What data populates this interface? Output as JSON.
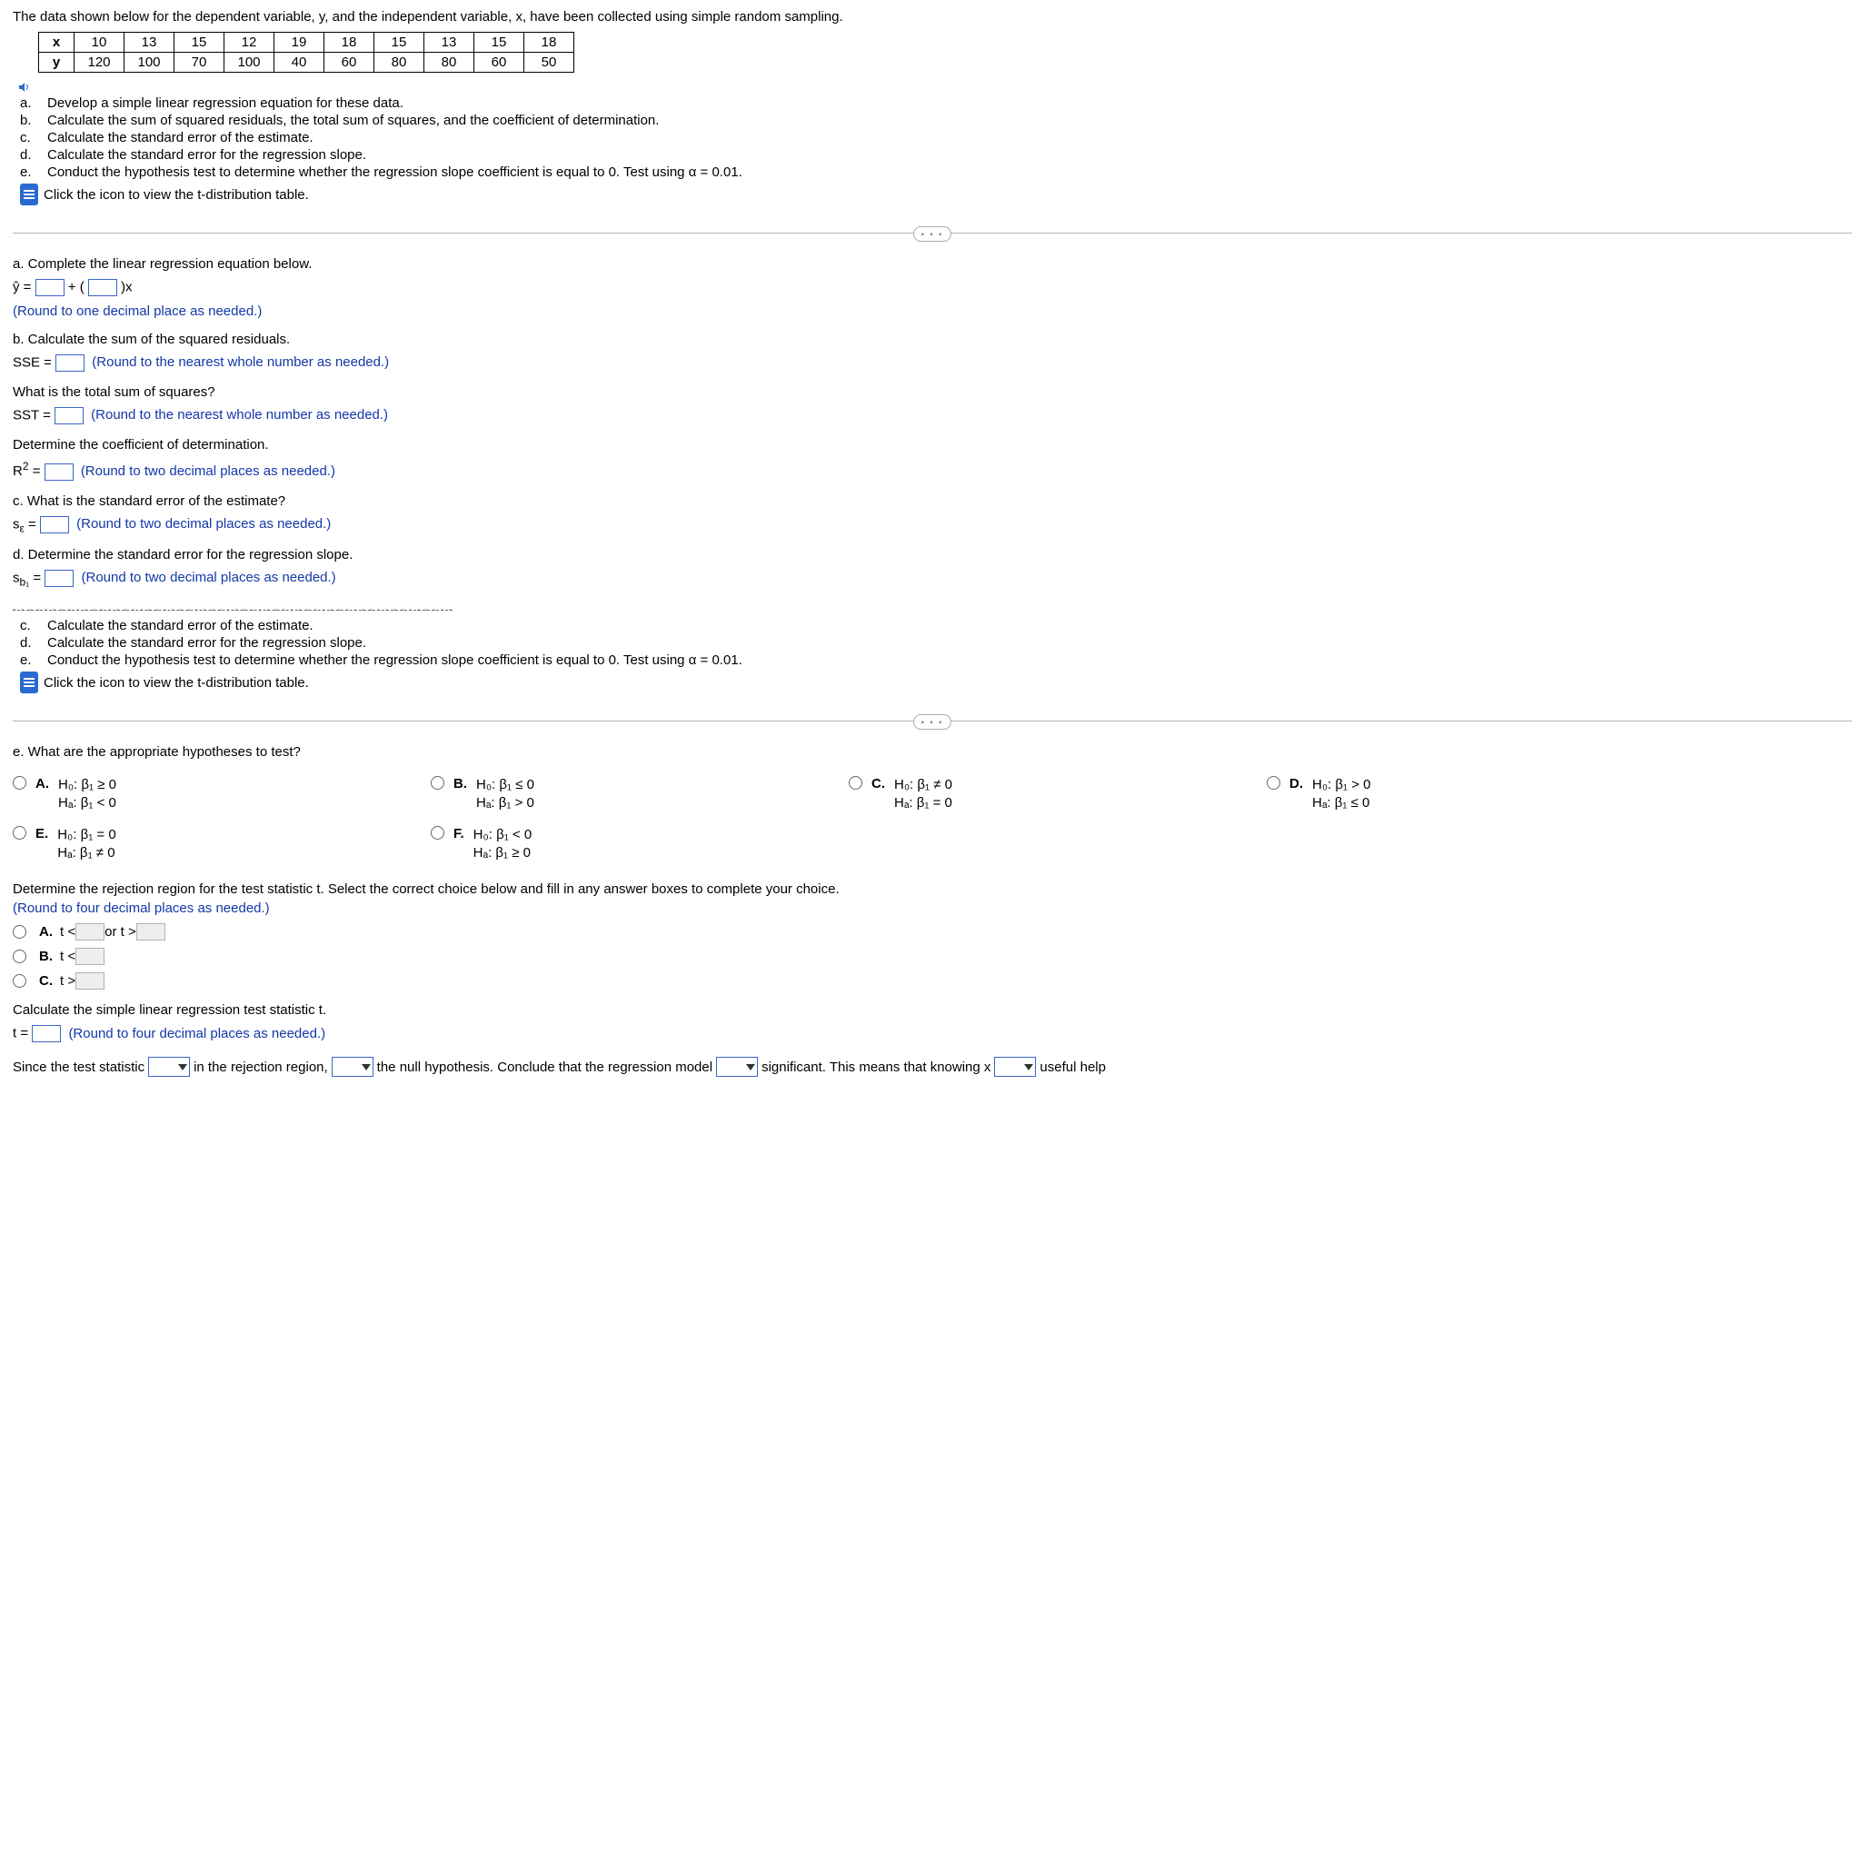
{
  "intro": "The data shown below for the dependent variable, y, and the independent variable, x, have been collected using simple random sampling.",
  "table": {
    "row_x_label": "x",
    "row_y_label": "y",
    "x": [
      "10",
      "13",
      "15",
      "12",
      "19",
      "18",
      "15",
      "13",
      "15",
      "18"
    ],
    "y": [
      "120",
      "100",
      "70",
      "100",
      "40",
      "60",
      "80",
      "80",
      "60",
      "50"
    ]
  },
  "tasks": {
    "a": "Develop a simple linear regression equation for these data.",
    "b": "Calculate the sum of squared residuals, the total sum of squares, and the coefficient of determination.",
    "c": "Calculate the standard error of the estimate.",
    "d": "Calculate the standard error for the regression slope.",
    "e": "Conduct the hypothesis test to determine whether the regression slope coefficient is equal to 0. Test using α = 0.01."
  },
  "icon_link": "Click the icon to view the t-distribution table.",
  "partA": {
    "prompt": "a. Complete the linear regression equation below.",
    "eq_pre": "ŷ = ",
    "eq_mid": " + ( ",
    "eq_post": " )x",
    "hint": "(Round to one decimal place as needed.)"
  },
  "partB": {
    "prompt": "b. Calculate the sum of the squared residuals.",
    "l1_pre": "SSE = ",
    "l1_hint": "(Round to the nearest whole number as needed.)",
    "q2": "What is the total sum of squares?",
    "l2_pre": "SST = ",
    "l2_hint": "(Round to the nearest whole number as needed.)",
    "q3": "Determine the coefficient of determination.",
    "l3_pre": "R",
    "l3_sup": "2",
    "l3_mid": " = ",
    "l3_hint": "(Round to two decimal places as needed.)"
  },
  "partC": {
    "prompt": "c. What is the standard error of the estimate?",
    "pre": "s",
    "sub": "ε",
    "mid": " = ",
    "hint": "(Round to two decimal places as needed.)"
  },
  "partD": {
    "prompt": "d. Determine the standard error for the regression slope.",
    "pre": "s",
    "sub": "b₁",
    "mid": " = ",
    "hint": "(Round to two decimal places as needed.)"
  },
  "partE": {
    "prompt": "e. What are the appropriate hypotheses to test?",
    "opts": {
      "A": {
        "h0": "H₀: β₁ ≥ 0",
        "ha": "Hₐ: β₁ < 0"
      },
      "B": {
        "h0": "H₀: β₁ ≤ 0",
        "ha": "Hₐ: β₁ > 0"
      },
      "C": {
        "h0": "H₀: β₁ ≠ 0",
        "ha": "Hₐ: β₁ = 0"
      },
      "D": {
        "h0": "H₀: β₁ > 0",
        "ha": "Hₐ: β₁ ≤ 0"
      },
      "E": {
        "h0": "H₀: β₁ = 0",
        "ha": "Hₐ: β₁ ≠ 0"
      },
      "F": {
        "h0": "H₀: β₁ < 0",
        "ha": "Hₐ: β₁ ≥ 0"
      }
    },
    "rr_prompt": "Determine the rejection region for the test statistic t. Select the correct choice below and fill in any answer boxes to complete your choice.",
    "rr_hint": "(Round to four decimal places as needed.)",
    "rrA_1": "t < ",
    "rrA_2": " or t > ",
    "rrB": "t < ",
    "rrC": "t > ",
    "tstat_prompt": "Calculate the simple linear regression test statistic t.",
    "tstat_pre": "t = ",
    "tstat_hint": "(Round to four decimal places as needed.)",
    "concl_1": "Since the test statistic ",
    "concl_2": " in the rejection region, ",
    "concl_3": " the null hypothesis. Conclude that the regression model ",
    "concl_4": " significant. This means that knowing x ",
    "concl_5": " useful help"
  },
  "labels": {
    "A": "A.",
    "B": "B.",
    "C": "C.",
    "D": "D.",
    "E": "E.",
    "F": "F."
  },
  "tasklbl": {
    "a": "a.",
    "b": "b.",
    "c": "c.",
    "d": "d.",
    "e": "e."
  }
}
